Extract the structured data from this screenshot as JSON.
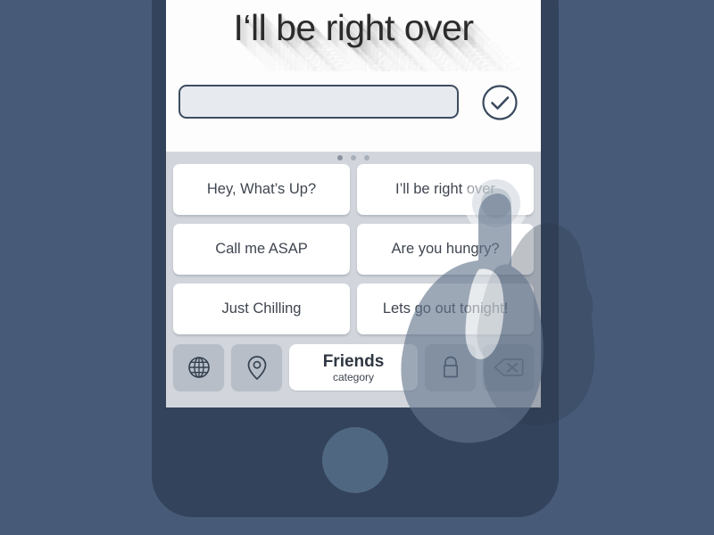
{
  "theme": {
    "background": "#475b79",
    "phone_body": "#33435b",
    "home_button": "#506782",
    "screen_background": "#ffffff",
    "keyboard_background": "#d2d6dc",
    "suggestion_button": "#ffffff",
    "tool_button": "#b7bec8",
    "text_primary": "#2b2b2b",
    "text_secondary": "#3f4550",
    "input_fill": "#e7eaee",
    "input_border": "#3d4c61"
  },
  "header": {
    "title": "I‘ll be right over"
  },
  "compose": {
    "input_value": "",
    "input_placeholder": "",
    "send_icon": "check-circle-icon",
    "send_label": "Send"
  },
  "pagination": {
    "dots": 3,
    "active_index": 0
  },
  "suggestions": [
    {
      "label": "Hey, What’s Up?"
    },
    {
      "label": "I’ll be right over"
    },
    {
      "label": "Call me ASAP"
    },
    {
      "label": "Are you hungry?"
    },
    {
      "label": "Just Chilling"
    },
    {
      "label": "Lets go out tonight!"
    }
  ],
  "toolbar": {
    "globe": {
      "icon": "globe-icon",
      "label": "Language"
    },
    "location": {
      "icon": "map-pin-icon",
      "label": "Location"
    },
    "category": {
      "name": "Friends",
      "sub": "category"
    },
    "lock": {
      "icon": "lock-icon",
      "label": "Lock"
    },
    "backspace": {
      "icon": "backspace-icon",
      "label": "Delete"
    }
  },
  "interaction": {
    "tapped_suggestion": "I’ll be right over",
    "tap_indicator": "touch-ripple"
  }
}
